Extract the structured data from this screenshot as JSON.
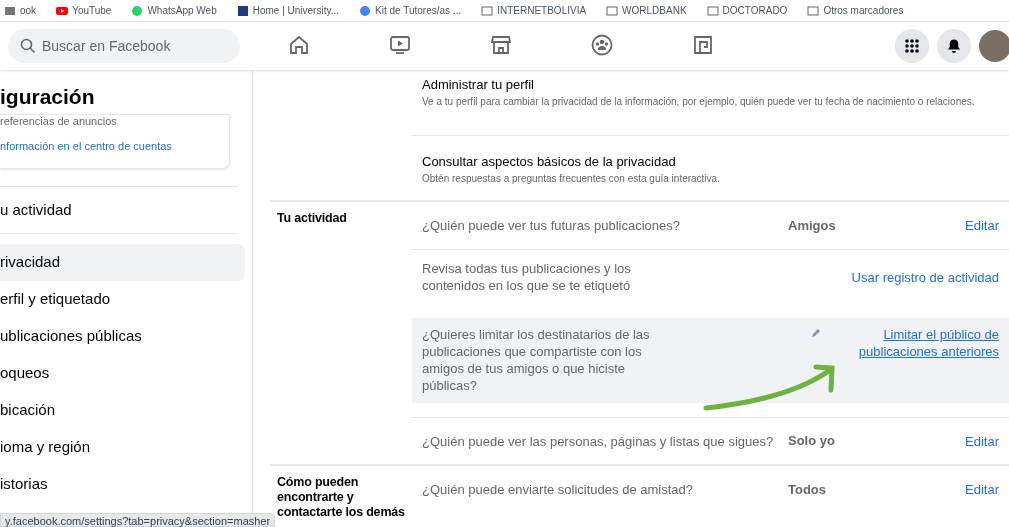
{
  "bookmarks": [
    {
      "label": "ook",
      "kind": "page"
    },
    {
      "label": "YouTube",
      "kind": "youtube"
    },
    {
      "label": "WhatsApp Web",
      "kind": "whatsapp"
    },
    {
      "label": "Home | University...",
      "kind": "site"
    },
    {
      "label": "Kit de Tutores/as ...",
      "kind": "google"
    },
    {
      "label": "INTERNETBOLIVIA",
      "kind": "folder"
    },
    {
      "label": "WORLDBANK",
      "kind": "folder"
    },
    {
      "label": "DOCTORADO",
      "kind": "folder"
    },
    {
      "label": "Otros marcadores",
      "kind": "folder"
    }
  ],
  "search": {
    "placeholder": "Buscar en Facebook"
  },
  "nav_tabs": [
    {
      "kind": "home",
      "selected": false
    },
    {
      "kind": "video",
      "selected": false
    },
    {
      "kind": "store",
      "selected": false
    },
    {
      "kind": "groups",
      "selected": false
    },
    {
      "kind": "gaming",
      "selected": false
    }
  ],
  "sidebar": {
    "title": "iguración",
    "card": [
      {
        "text": "referencias de anuncios",
        "kind": "plain"
      },
      {
        "text": "nformación en el centro de cuentas",
        "kind": "link"
      }
    ],
    "top_item": "u actividad",
    "items": [
      {
        "label": "rivacidad",
        "selected": true
      },
      {
        "label": "erfil y etiquetado",
        "selected": false
      },
      {
        "label": "ublicaciones públicas",
        "selected": false
      },
      {
        "label": "oqueos",
        "selected": false
      },
      {
        "label": "bicación",
        "selected": false
      },
      {
        "label": "ioma y región",
        "selected": false
      },
      {
        "label": "istorias",
        "selected": false
      }
    ]
  },
  "intro_rows": [
    {
      "title": "Administrar tu perfil",
      "description": "Ve a tu perfil para cambiar la privacidad de la información, por ejemplo, quién puede ver tu fecha de nacimiento o relaciones."
    },
    {
      "title": "Consultar aspectos básicos de la privacidad",
      "description": "Obtén respuestas a preguntas frecuentes con esta guía interactiva."
    }
  ],
  "sections": [
    {
      "heading": "Tu actividad",
      "rows": [
        {
          "kind": "setting",
          "question": "¿Quién puede ver tus futuras publicaciones?",
          "value": "Amigos",
          "action": "Editar"
        },
        {
          "kind": "link",
          "question": "Revisa todas tus publicaciones y los contenidos en los que se te etiquetó",
          "action": "Usar registro de actividad"
        },
        {
          "kind": "prompt",
          "question": "¿Quieres limitar los destinatarios de las publicaciones que compartiste con los amigos de tus amigos o que hiciste públicas?",
          "action": "Limitar el público de publicaciones anteriores"
        },
        {
          "kind": "setting",
          "question": "¿Quién puede ver las personas, páginas y listas que sigues?",
          "value": "Solo yo",
          "action": "Editar"
        }
      ]
    },
    {
      "heading": "Cómo pueden encontrarte y contactarte los demás",
      "rows": [
        {
          "kind": "setting",
          "question": "¿Quién puede enviarte solicitudes de amistad?",
          "value": "Todos",
          "action": "Editar"
        }
      ]
    }
  ],
  "status_url": "y.facebook.com/settings?tab=privacy&section=masher"
}
